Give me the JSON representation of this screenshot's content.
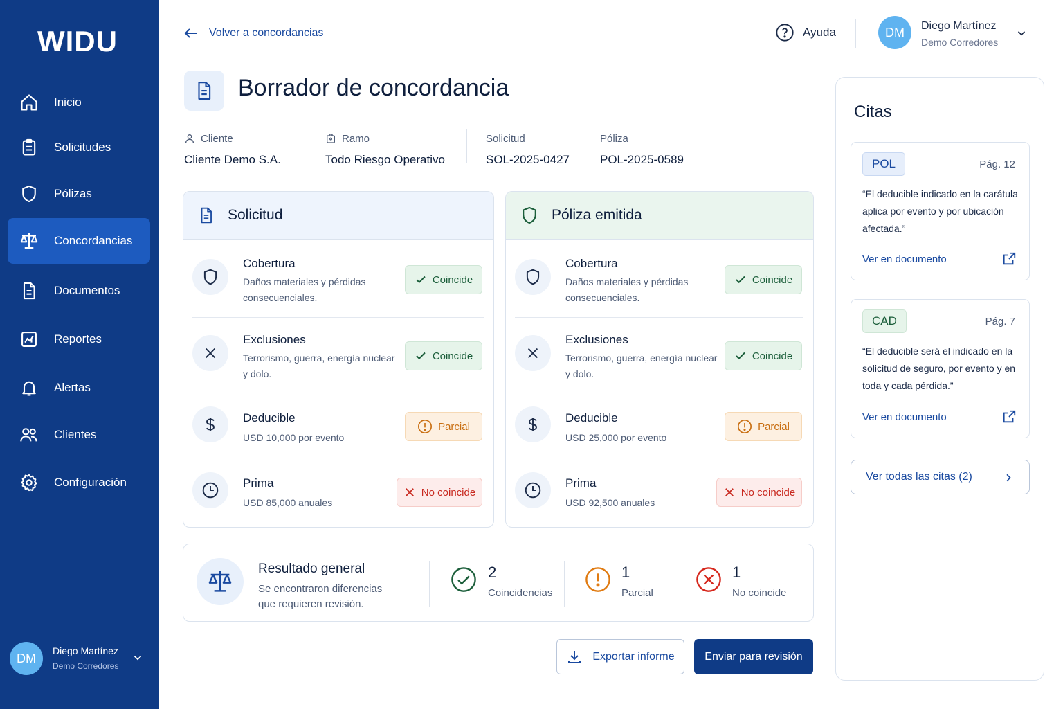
{
  "sidebar": {
    "logo": "WIDU",
    "items": [
      {
        "label": "Inicio",
        "icon": "home-icon"
      },
      {
        "label": "Solicitudes",
        "icon": "clipboard-icon"
      },
      {
        "label": "Pólizas",
        "icon": "shield-icon"
      },
      {
        "label": "Concordancias",
        "icon": "scale-icon",
        "active": true
      },
      {
        "label": "Documentos",
        "icon": "document-icon"
      },
      {
        "label": "Reportes",
        "icon": "chart-icon"
      },
      {
        "label": "Alertas",
        "icon": "bell-icon"
      },
      {
        "label": "Clientes",
        "icon": "users-icon"
      },
      {
        "label": "Configuración",
        "icon": "gear-icon"
      }
    ],
    "user": {
      "initials": "DM",
      "name": "Diego Martínez",
      "org": "Demo Corredores"
    }
  },
  "header": {
    "back_label": "Volver a concordancias",
    "help_label": "Ayuda",
    "user": {
      "initials": "DM",
      "name": "Diego Martínez",
      "org": "Demo Corredores"
    }
  },
  "page": {
    "title": "Borrador de concordancia"
  },
  "meta": {
    "cliente_label": "Cliente",
    "cliente_value": "Cliente Demo S.A.",
    "ramo_label": "Ramo",
    "ramo_value": "Todo Riesgo Operativo",
    "solicitud_label": "Solicitud",
    "solicitud_value": "SOL-2025-0427",
    "poliza_label": "Póliza",
    "poliza_value": "POL-2025-0589"
  },
  "solicitud": {
    "title": "Solicitud",
    "rows": [
      {
        "title": "Cobertura",
        "desc": "Daños materiales y pérdidas consecuenciales.",
        "status": "Coincide"
      },
      {
        "title": "Exclusiones",
        "desc": "Terrorismo, guerra, energía nuclear y dolo.",
        "status": "Coincide"
      },
      {
        "title": "Deducible",
        "desc": "USD 10,000 por evento",
        "status": "Parcial"
      },
      {
        "title": "Prima",
        "desc": "USD 85,000 anuales",
        "status": "No coincide"
      }
    ]
  },
  "poliza": {
    "title": "Póliza emitida",
    "rows": [
      {
        "title": "Cobertura",
        "desc": "Daños materiales y pérdidas consecuenciales.",
        "status": "Coincide"
      },
      {
        "title": "Exclusiones",
        "desc": "Terrorismo, guerra, energía nuclear y dolo.",
        "status": "Coincide"
      },
      {
        "title": "Deducible",
        "desc": "USD 25,000 por evento",
        "status": "Parcial"
      },
      {
        "title": "Prima",
        "desc": "USD 92,500 anuales",
        "status": "No coincide"
      }
    ]
  },
  "result": {
    "title": "Resultado general",
    "desc": "Se encontraron diferencias que requieren revisión.",
    "stats": [
      {
        "num": "2",
        "label": "Coincidencias"
      },
      {
        "num": "1",
        "label": "Parcial"
      },
      {
        "num": "1",
        "label": "No coincide"
      }
    ]
  },
  "actions": {
    "export_label": "Exportar informe",
    "send_label": "Enviar para revisión"
  },
  "citas": {
    "title": "Citas",
    "cards": [
      {
        "tag": "POL",
        "page": "Pág. 12",
        "quote": "“El deducible indicado en la carátula aplica por evento y por ubicación afectada.”",
        "link": "Ver en documento"
      },
      {
        "tag": "CAD",
        "page": "Pág. 7",
        "quote": "“El deducible será el indicado en la solicitud de seguro, por evento y en toda y cada pérdida.”",
        "link": "Ver en documento"
      }
    ],
    "all_label": "Ver todas las citas (2)"
  },
  "colors": {
    "sidebar_bg": "#0f3b86",
    "active_item": "#1d5bbf",
    "ok": "#1b5e3a",
    "partial": "#c96f12",
    "bad": "#c8281f"
  }
}
